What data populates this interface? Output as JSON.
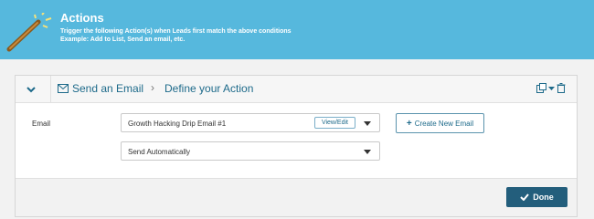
{
  "header": {
    "title": "Actions",
    "subtitle_line1": "Trigger the following Action(s) when Leads first match the above conditions",
    "subtitle_line2": "Example: Add to List, Send an email, etc.",
    "icon": "magic-wand-icon"
  },
  "action_panel": {
    "breadcrumb_action": "Send an Email",
    "breadcrumb_separator": "›",
    "breadcrumb_step": "Define your Action",
    "icons": [
      "chevron-down-icon",
      "envelope-icon",
      "copy-icon",
      "caret-down-icon",
      "trash-icon"
    ]
  },
  "form": {
    "email_label": "Email",
    "email_select_value": "Growth Hacking Drip Email #1",
    "view_edit_label": "View/Edit",
    "create_email_label": "Create New Email",
    "send_mode_value": "Send Automatically"
  },
  "footer": {
    "done_label": "Done"
  },
  "colors": {
    "header_bg": "#56b8dd",
    "accent": "#1d6a8a",
    "done_bg": "#235e7c"
  }
}
